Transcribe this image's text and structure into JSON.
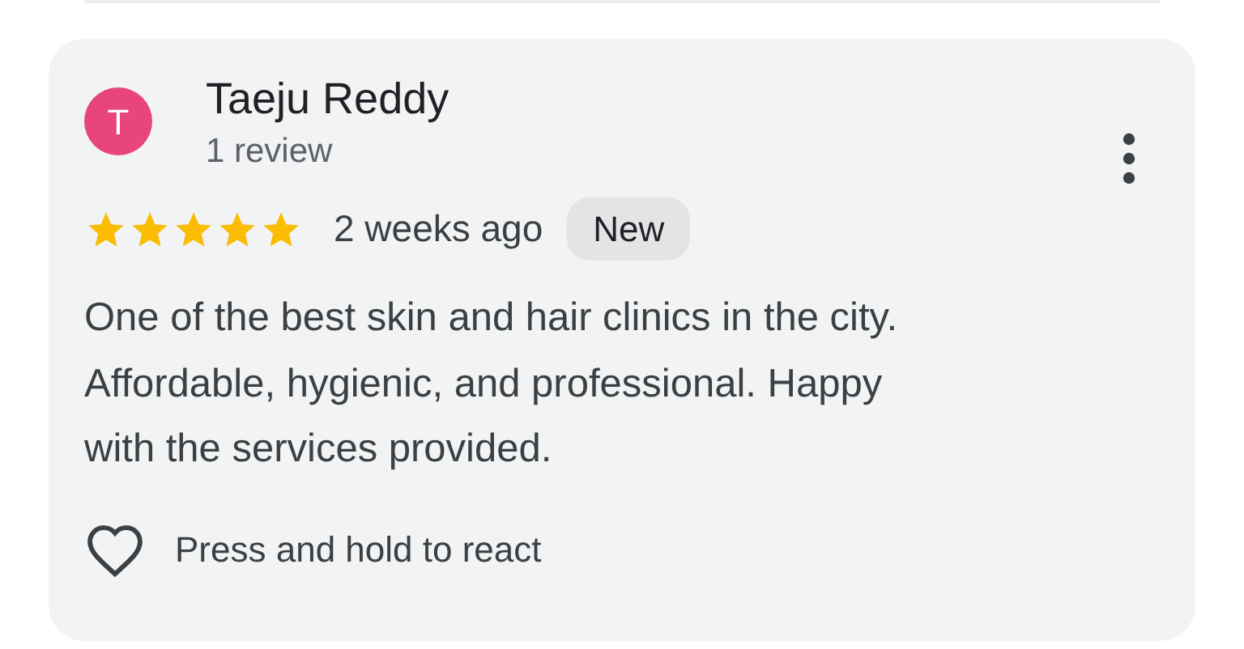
{
  "review": {
    "avatar_letter": "T",
    "author": "Taeju Reddy",
    "author_meta": "1 review",
    "stars": 5,
    "time": "2 weeks ago",
    "badge": "New",
    "text": "One of the best skin and hair clinics in the city. Affordable, hygienic, and professional. Happy with the services provided.",
    "reaction_hint": "Press and hold to react"
  }
}
